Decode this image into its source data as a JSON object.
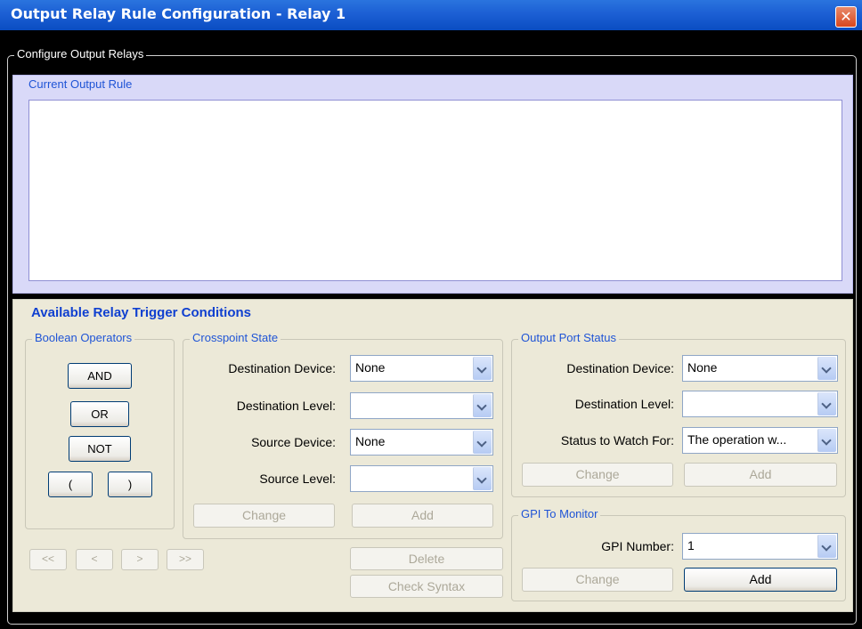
{
  "window": {
    "title": "Output Relay Rule Configuration - Relay 1",
    "close_glyph": "✕"
  },
  "configure_group": {
    "label": "Configure Output Relays"
  },
  "current_rule": {
    "label": "Current Output Rule",
    "text": ""
  },
  "conditions": {
    "heading": "Available Relay Trigger Conditions",
    "boolean_operators": {
      "label": "Boolean Operators",
      "and": "AND",
      "or": "OR",
      "not": "NOT",
      "open_paren": "(",
      "close_paren": ")"
    },
    "crosspoint_state": {
      "label": "Crosspoint State",
      "destination_device_label": "Destination Device:",
      "destination_device_value": "None",
      "destination_level_label": "Destination Level:",
      "destination_level_value": "",
      "source_device_label": "Source Device:",
      "source_device_value": "None",
      "source_level_label": "Source Level:",
      "source_level_value": "",
      "change": "Change",
      "add": "Add"
    },
    "navigation": {
      "first": "<<",
      "prev": "<",
      "next": ">",
      "last": ">>"
    },
    "delete": "Delete",
    "check_syntax": "Check Syntax",
    "output_port_status": {
      "label": "Output Port Status",
      "destination_device_label": "Destination Device:",
      "destination_device_value": "None",
      "destination_level_label": "Destination Level:",
      "destination_level_value": "",
      "status_label": "Status to Watch For:",
      "status_value": "The operation w...",
      "change": "Change",
      "add": "Add"
    },
    "gpi_to_monitor": {
      "label": "GPI To Monitor",
      "gpi_number_label": "GPI Number:",
      "gpi_number_value": "1",
      "change": "Change",
      "add": "Add"
    }
  }
}
